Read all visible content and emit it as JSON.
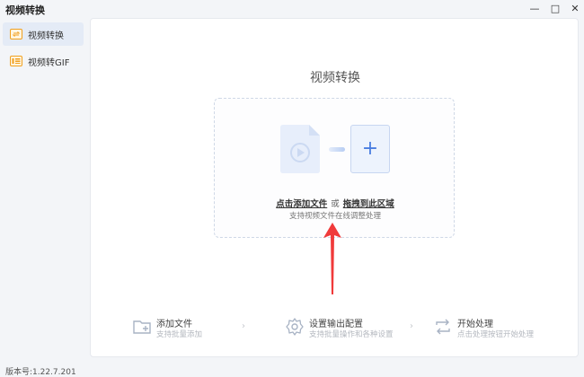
{
  "app": {
    "title": "视频转换"
  },
  "window_controls": [
    {
      "name": "minimize-button",
      "glyph": "—"
    },
    {
      "name": "maximize-button",
      "glyph": "□"
    },
    {
      "name": "close-button",
      "glyph": "✕"
    }
  ],
  "sidebar": {
    "items": [
      {
        "label": "视频转换",
        "icon": "video-convert-icon",
        "active": true
      },
      {
        "label": "视频转GIF",
        "icon": "gif-icon",
        "active": false
      }
    ]
  },
  "main": {
    "title": "视频转换",
    "dropzone": {
      "add_link": "点击添加文件",
      "separator": "或",
      "drag_link": "拖拽到此区域",
      "subtext": "支持视频文件在线调整处理",
      "plus": "+"
    },
    "steps": [
      {
        "title": "添加文件",
        "desc": "支持批量添加",
        "icon": "folder-add-icon"
      },
      {
        "title": "设置输出配置",
        "desc": "支持批量操作和各种设置",
        "icon": "settings-gear-icon"
      },
      {
        "title": "开始处理",
        "desc": "点击处理按钮开始处理",
        "icon": "process-cycle-icon"
      }
    ],
    "chevron": "›"
  },
  "footer": {
    "version": "版本号:1.22.7.201"
  },
  "colors": {
    "accent": "#4a7de0",
    "sidebar_active": "#e4ebf6",
    "annotation_arrow": "#f03a3a",
    "icon_orange": "#f0a020"
  }
}
